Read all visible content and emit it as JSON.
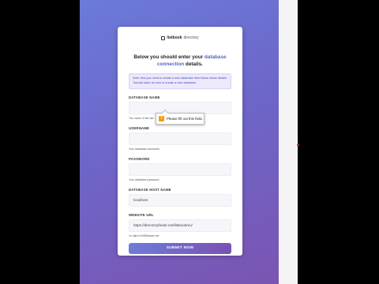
{
  "brand": {
    "name_bold": "listbook",
    "name_light": "directory",
    "icon": "book-icon"
  },
  "heading": {
    "prefix": "Below you should enter your",
    "link": "database connection",
    "suffix": "details."
  },
  "notice": {
    "text": "Note: first you need to create a new database then follow below details. Tutorial video for how to create a new database."
  },
  "fields": {
    "db_name": {
      "label": "DATABASE NAME",
      "value": "",
      "help": "The name of the dat"
    },
    "username": {
      "label": "USERNAME",
      "value": "",
      "help": "Your database username"
    },
    "password": {
      "label": "PASSWORD",
      "value": "",
      "help": "Your database password"
    },
    "host": {
      "label": "DATABASE HOST NAME",
      "value": "localhost"
    },
    "url": {
      "label": "WEBSITE URL",
      "value": "https://directoryfinder.net/listbookrev/",
      "help": "i.e https://c9Sfibaase.net"
    }
  },
  "submit_label": "SUBMIT NOW",
  "tooltip": {
    "text": "Please fill out this field.",
    "icon": "warning-icon"
  },
  "colors": {
    "accent": "#4a67c9",
    "gradient_start": "#6b7ad8",
    "gradient_end": "#7b55b2"
  }
}
